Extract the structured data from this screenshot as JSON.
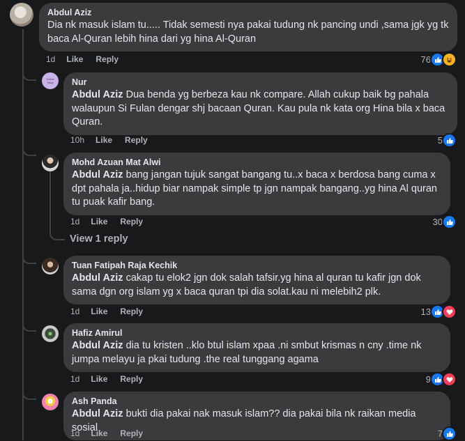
{
  "comments": [
    {
      "author": "Abdul Aziz",
      "mention": "",
      "text": "Dia nk masuk islam tu..... Tidak semesti nya pakai tudung nk pancing undi ,sama jgk yg tk baca Al-Quran lebih hina dari yg hina Al-Quran",
      "time": "1d",
      "like": "Like",
      "reply": "Reply",
      "reactions": "76"
    },
    {
      "author": "Nur",
      "avatar_text": "Online Shop",
      "mention": "Abdul Aziz",
      "text": " Dua benda yg berbeza kau nk compare. Allah cukup baik bg pahala walaupun Si Fulan dengar shj bacaan Quran. Kau pula nk kata org Hina bila x baca Quran.",
      "time": "10h",
      "like": "Like",
      "reply": "Reply",
      "reactions": "5"
    },
    {
      "author": "Mohd Azuan Mat Alwi",
      "mention": "Abdul Aziz",
      "text": " bang jangan tujuk sangat bangang tu..x baca x berdosa bang cuma x dpt pahala ja..hidup biar nampak simple tp jgn nampak bangang..yg hina Al quran tu puak kafir bang.",
      "time": "1d",
      "like": "Like",
      "reply": "Reply",
      "reactions": "30"
    },
    {
      "author": "Tuan Fatipah Raja Kechik",
      "mention": "Abdul Aziz",
      "text": " cakap tu elok2 jgn dok salah tafsir.yg hina al quran tu kafir jgn dok sama dgn org islam yg x baca quran tpi dia solat.kau ni melebih2 plk.",
      "time": "1d",
      "like": "Like",
      "reply": "Reply",
      "reactions": "13"
    },
    {
      "author": "Hafiz Amirul",
      "mention": "Abdul Aziz",
      "text": " dia tu kristen ..klo btul islam xpaa .ni smbut krismas n cny .time nk jumpa melayu ja pkai tudung .the real tunggang agama",
      "time": "1d",
      "like": "Like",
      "reply": "Reply",
      "reactions": "9"
    },
    {
      "author": "Ash Panda",
      "mention": "Abdul Aziz",
      "text": " bukti dia pakai nak masuk islam?? dia pakai bila nk raikan media sosial",
      "time": "1d",
      "like": "Like",
      "reply": "Reply",
      "reactions": "7"
    }
  ],
  "view_replies": "View 1 reply",
  "icons": {
    "like": "thumbs-up-icon",
    "love": "heart-icon",
    "haha": "laugh-icon"
  },
  "colors": {
    "bg": "#18191a",
    "bubble": "#3a3b3c",
    "like": "#1877f2",
    "love": "#f33e58",
    "haha": "#f7b125"
  }
}
